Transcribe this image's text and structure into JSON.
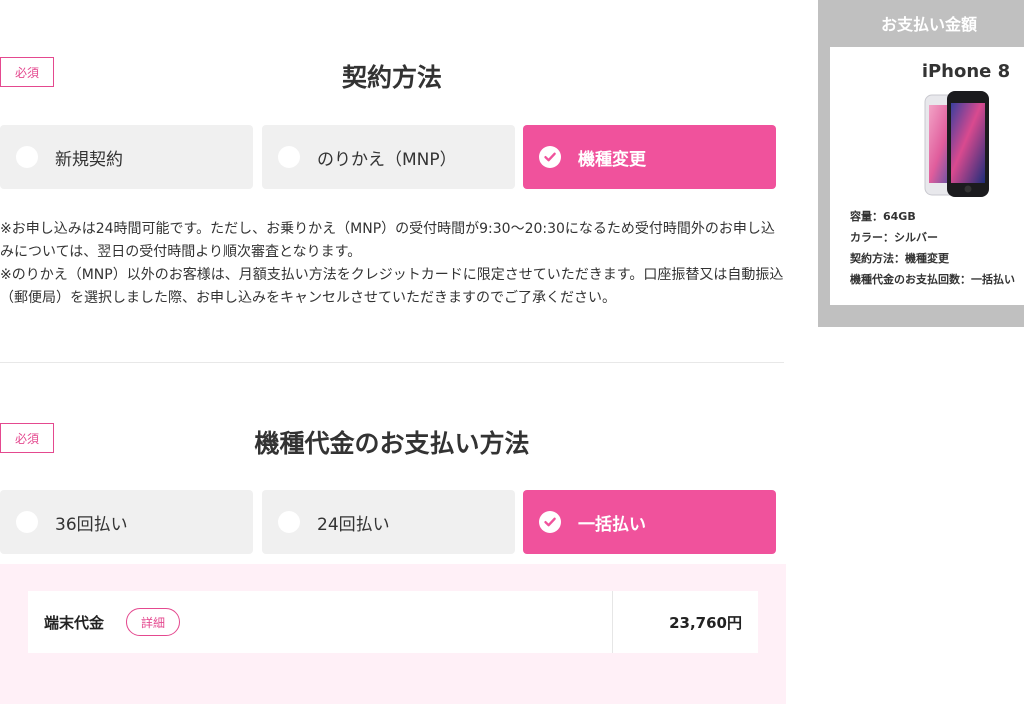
{
  "contract": {
    "required_label": "必須",
    "title": "契約方法",
    "options": [
      {
        "label": "新規契約",
        "selected": false
      },
      {
        "label": "のりかえ（MNP）",
        "selected": false
      },
      {
        "label": "機種変更",
        "selected": true
      }
    ],
    "notes": [
      "※お申し込みは24時間可能です。ただし、お乗りかえ（MNP）の受付時間が9:30〜20:30になるため受付時間外のお申し込みについては、翌日の受付時間より順次審査となります。",
      "※のりかえ（MNP）以外のお客様は、月額支払い方法をクレジットカードに限定させていただきます。口座振替又は自動振込（郵便局）を選択しました際、お申し込みをキャンセルさせていただきますのでご了承ください。"
    ]
  },
  "payment": {
    "required_label": "必須",
    "title": "機種代金のお支払い方法",
    "options": [
      {
        "label": "36回払い",
        "selected": false
      },
      {
        "label": "24回払い",
        "selected": false
      },
      {
        "label": "一括払い",
        "selected": true
      }
    ],
    "row": {
      "label": "端末代金",
      "detail_button": "詳細",
      "amount": "23,760円"
    }
  },
  "summary": {
    "header": "お支払い金額",
    "product_name": "iPhone 8",
    "specs": [
      "容量：64GB",
      "カラー：シルバー",
      "契約方法：機種変更",
      "機種代金のお支払回数：一括払い"
    ]
  },
  "colors": {
    "accent": "#f0529c",
    "accent_border": "#e4498f",
    "option_bg": "#f0f0f0",
    "pink_bg": "#fff0f7",
    "summary_bg": "#c0c0c0"
  },
  "icons": [
    "check-icon",
    "phone-image"
  ]
}
